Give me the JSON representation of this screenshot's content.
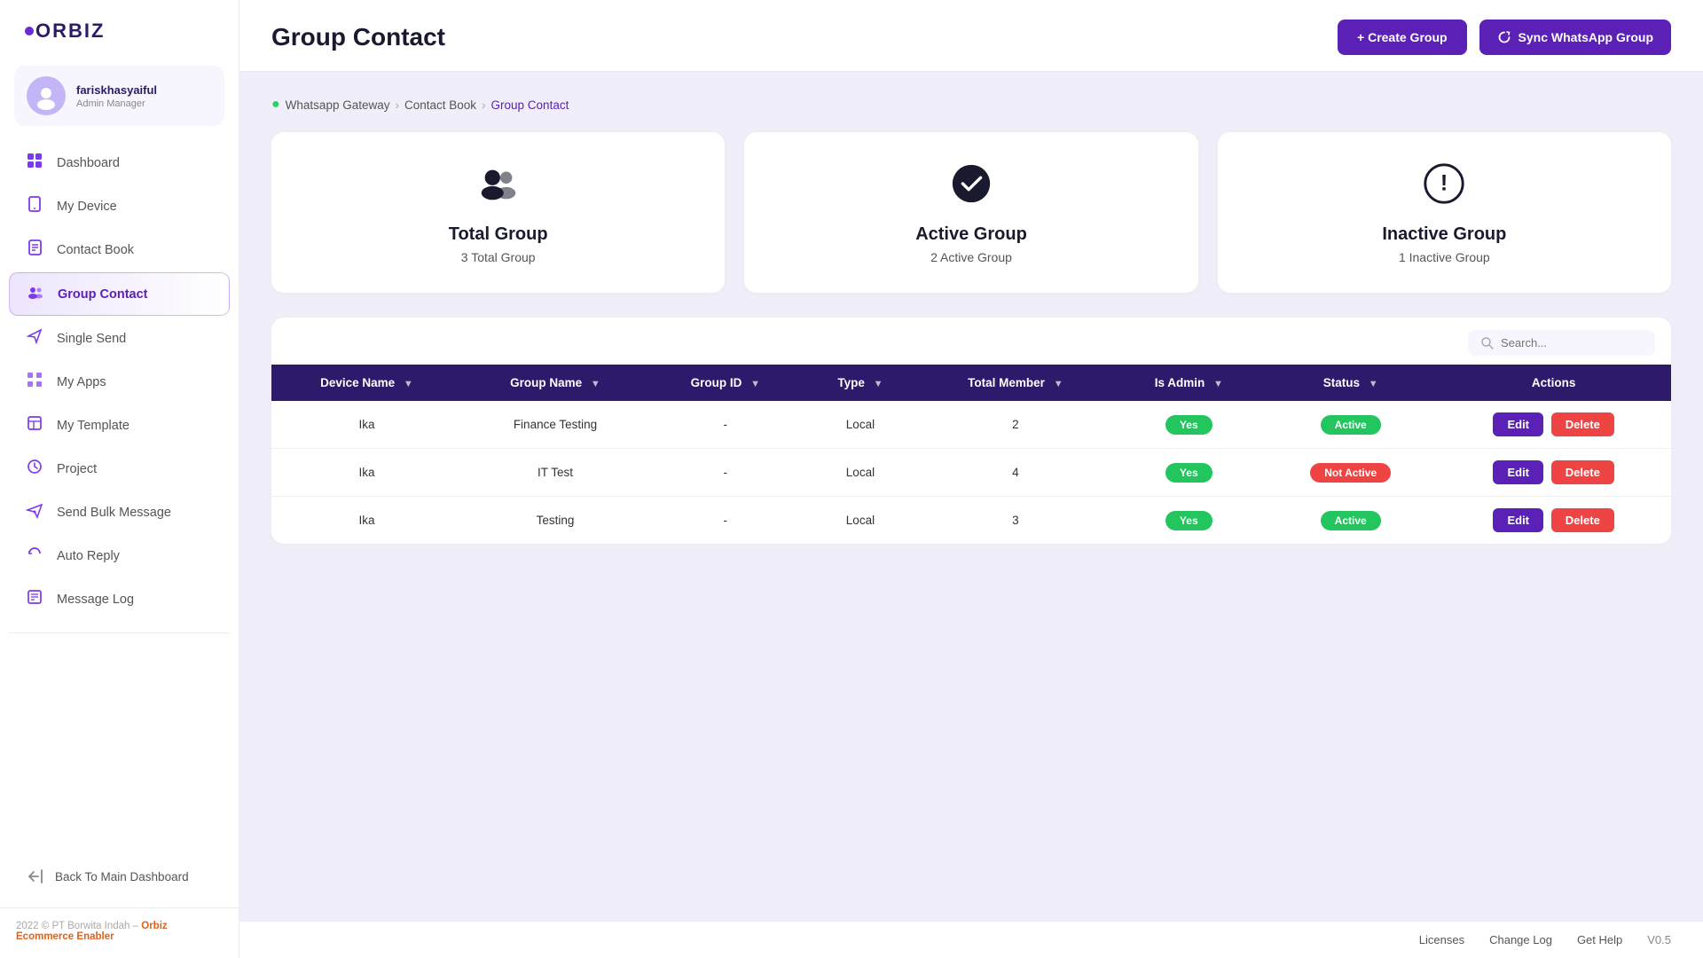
{
  "brand": {
    "name": "ORBIZ"
  },
  "user": {
    "name": "fariskhasyaiful",
    "role": "Admin Manager"
  },
  "sidebar": {
    "items": [
      {
        "id": "dashboard",
        "label": "Dashboard",
        "icon": "grid"
      },
      {
        "id": "my-device",
        "label": "My Device",
        "icon": "device"
      },
      {
        "id": "contact-book",
        "label": "Contact Book",
        "icon": "book"
      },
      {
        "id": "group-contact",
        "label": "Group Contact",
        "icon": "group",
        "active": true
      },
      {
        "id": "single-send",
        "label": "Single Send",
        "icon": "send"
      },
      {
        "id": "my-apps",
        "label": "My Apps",
        "icon": "apps"
      },
      {
        "id": "my-template",
        "label": "My Template",
        "icon": "template"
      },
      {
        "id": "project",
        "label": "Project",
        "icon": "project"
      },
      {
        "id": "send-bulk-message",
        "label": "Send Bulk Message",
        "icon": "bulk"
      },
      {
        "id": "auto-reply",
        "label": "Auto Reply",
        "icon": "reply"
      },
      {
        "id": "message-log",
        "label": "Message Log",
        "icon": "log"
      }
    ],
    "back_label": "Back To Main Dashboard"
  },
  "breadcrumb": {
    "items": [
      "Whatsapp Gateway",
      "Contact Book",
      "Group Contact"
    ]
  },
  "page": {
    "title": "Group Contact"
  },
  "buttons": {
    "create_group": "+ Create Group",
    "sync_whatsapp": "Sync WhatsApp Group"
  },
  "stats": [
    {
      "label": "Total Group",
      "value": "3 Total Group",
      "icon": "people"
    },
    {
      "label": "Active Group",
      "value": "2 Active Group",
      "icon": "checkmark"
    },
    {
      "label": "Inactive Group",
      "value": "1 Inactive Group",
      "icon": "warning"
    }
  ],
  "table": {
    "search_placeholder": "Search...",
    "columns": [
      "Device Name",
      "Group Name",
      "Group ID",
      "Type",
      "Total Member",
      "Is Admin",
      "Status",
      "Actions"
    ],
    "rows": [
      {
        "device": "Ika",
        "group_name": "Finance Testing",
        "group_id": "-",
        "type": "Local",
        "total_member": "2",
        "is_admin": "Yes",
        "status": "Active"
      },
      {
        "device": "Ika",
        "group_name": "IT Test",
        "group_id": "-",
        "type": "Local",
        "total_member": "4",
        "is_admin": "Yes",
        "status": "Not Active"
      },
      {
        "device": "Ika",
        "group_name": "Testing",
        "group_id": "-",
        "type": "Local",
        "total_member": "3",
        "is_admin": "Yes",
        "status": "Active"
      }
    ],
    "actions": {
      "edit": "Edit",
      "delete": "Delete"
    }
  },
  "footer": {
    "copyright": "2022 © PT Borwita Indah –",
    "brand_link": "Orbiz Ecommerce Enabler",
    "links": [
      "Licenses",
      "Change Log",
      "Get Help"
    ],
    "version": "V0.5"
  }
}
